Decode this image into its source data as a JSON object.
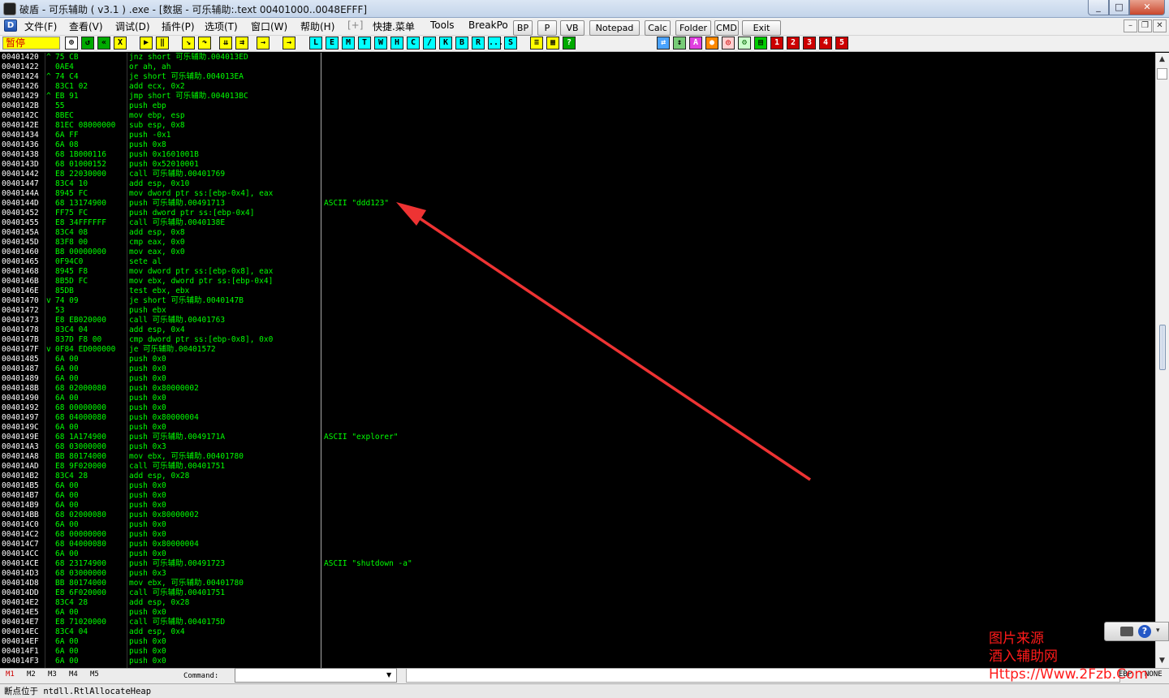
{
  "window": {
    "title": "破盾 - 可乐辅助 ( v3.1 ) .exe - [数据 - 可乐辅助:.text 00401000..0048EFFF]",
    "min": "_",
    "max": "□",
    "close": "✕"
  },
  "menu": [
    "文件(F)",
    "查看(V)",
    "调试(D)",
    "插件(P)",
    "选项(T)",
    "窗口(W)",
    "帮助(H)",
    "[+]",
    "快捷.菜单",
    "Tools",
    "BreakPo"
  ],
  "menu_mdi": [
    "–",
    "❐",
    "✕"
  ],
  "tool_buttons": [
    "BP",
    "P",
    "VB",
    "Notepad",
    "Calc",
    "Folder",
    "CMD",
    "Exit"
  ],
  "status_paused": "暂停",
  "letter_icons": [
    "L",
    "E",
    "M",
    "T",
    "W",
    "H",
    "C",
    "/",
    "K",
    "B",
    "R",
    "...",
    "S"
  ],
  "number_icons": [
    "1",
    "2",
    "3",
    "4",
    "5"
  ],
  "colors": {
    "code_text": "#00ff00",
    "address_text": "#ffffff",
    "background": "#000000",
    "paused_bg": "#ffff00",
    "paused_text": "#d00000",
    "arrow": "#ee3333",
    "watermark": "#ff1a1a"
  },
  "rows": [
    {
      "addr": "00401420",
      "jmp": "^",
      "hex": "75 CB",
      "dis": "jnz short 可乐辅助.004013ED",
      "comment": ""
    },
    {
      "addr": "00401422",
      "jmp": "",
      "hex": "0AE4",
      "dis": "or ah, ah",
      "comment": ""
    },
    {
      "addr": "00401424",
      "jmp": "^",
      "hex": "74 C4",
      "dis": "je short 可乐辅助.004013EA",
      "comment": ""
    },
    {
      "addr": "00401426",
      "jmp": "",
      "hex": "83C1 02",
      "dis": "add ecx, 0x2",
      "comment": ""
    },
    {
      "addr": "00401429",
      "jmp": "^",
      "hex": "EB 91",
      "dis": "jmp short 可乐辅助.004013BC",
      "comment": ""
    },
    {
      "addr": "0040142B",
      "jmp": "",
      "hex": "55",
      "dis": "push ebp",
      "comment": ""
    },
    {
      "addr": "0040142C",
      "jmp": "",
      "hex": "8BEC",
      "dis": "mov ebp, esp",
      "comment": ""
    },
    {
      "addr": "0040142E",
      "jmp": "",
      "hex": "81EC 08000000",
      "dis": "sub esp, 0x8",
      "comment": ""
    },
    {
      "addr": "00401434",
      "jmp": "",
      "hex": "6A FF",
      "dis": "push -0x1",
      "comment": ""
    },
    {
      "addr": "00401436",
      "jmp": "",
      "hex": "6A 08",
      "dis": "push 0x8",
      "comment": ""
    },
    {
      "addr": "00401438",
      "jmp": "",
      "hex": "68 1B000116",
      "dis": "push 0x1601001B",
      "comment": ""
    },
    {
      "addr": "0040143D",
      "jmp": "",
      "hex": "68 01000152",
      "dis": "push 0x52010001",
      "comment": ""
    },
    {
      "addr": "00401442",
      "jmp": "",
      "hex": "E8 22030000",
      "dis": "call 可乐辅助.00401769",
      "comment": ""
    },
    {
      "addr": "00401447",
      "jmp": "",
      "hex": "83C4 10",
      "dis": "add esp, 0x10",
      "comment": ""
    },
    {
      "addr": "0040144A",
      "jmp": "",
      "hex": "8945 FC",
      "dis": "mov dword ptr ss:[ebp-0x4], eax",
      "comment": ""
    },
    {
      "addr": "0040144D",
      "jmp": "",
      "hex": "68 13174900",
      "dis": "push 可乐辅助.00491713",
      "comment": "ASCII \"ddd123\""
    },
    {
      "addr": "00401452",
      "jmp": "",
      "hex": "FF75 FC",
      "dis": "push dword ptr ss:[ebp-0x4]",
      "comment": ""
    },
    {
      "addr": "00401455",
      "jmp": "",
      "hex": "E8 34FFFFFF",
      "dis": "call 可乐辅助.0040138E",
      "comment": ""
    },
    {
      "addr": "0040145A",
      "jmp": "",
      "hex": "83C4 08",
      "dis": "add esp, 0x8",
      "comment": ""
    },
    {
      "addr": "0040145D",
      "jmp": "",
      "hex": "83F8 00",
      "dis": "cmp eax, 0x0",
      "comment": ""
    },
    {
      "addr": "00401460",
      "jmp": "",
      "hex": "B8 00000000",
      "dis": "mov eax, 0x0",
      "comment": ""
    },
    {
      "addr": "00401465",
      "jmp": "",
      "hex": "0F94C0",
      "dis": "sete al",
      "comment": ""
    },
    {
      "addr": "00401468",
      "jmp": "",
      "hex": "8945 F8",
      "dis": "mov dword ptr ss:[ebp-0x8], eax",
      "comment": ""
    },
    {
      "addr": "0040146B",
      "jmp": "",
      "hex": "8B5D FC",
      "dis": "mov ebx, dword ptr ss:[ebp-0x4]",
      "comment": ""
    },
    {
      "addr": "0040146E",
      "jmp": "",
      "hex": "85DB",
      "dis": "test ebx, ebx",
      "comment": ""
    },
    {
      "addr": "00401470",
      "jmp": "v",
      "hex": "74 09",
      "dis": "je short 可乐辅助.0040147B",
      "comment": ""
    },
    {
      "addr": "00401472",
      "jmp": "",
      "hex": "53",
      "dis": "push ebx",
      "comment": ""
    },
    {
      "addr": "00401473",
      "jmp": "",
      "hex": "E8 EB020000",
      "dis": "call 可乐辅助.00401763",
      "comment": ""
    },
    {
      "addr": "00401478",
      "jmp": "",
      "hex": "83C4 04",
      "dis": "add esp, 0x4",
      "comment": ""
    },
    {
      "addr": "0040147B",
      "jmp": "",
      "hex": "837D F8 00",
      "dis": "cmp dword ptr ss:[ebp-0x8], 0x0",
      "comment": ""
    },
    {
      "addr": "0040147F",
      "jmp": "v",
      "hex": "0F84 ED000000",
      "dis": "je 可乐辅助.00401572",
      "comment": ""
    },
    {
      "addr": "00401485",
      "jmp": "",
      "hex": "6A 00",
      "dis": "push 0x0",
      "comment": ""
    },
    {
      "addr": "00401487",
      "jmp": "",
      "hex": "6A 00",
      "dis": "push 0x0",
      "comment": ""
    },
    {
      "addr": "00401489",
      "jmp": "",
      "hex": "6A 00",
      "dis": "push 0x0",
      "comment": ""
    },
    {
      "addr": "0040148B",
      "jmp": "",
      "hex": "68 02000080",
      "dis": "push 0x80000002",
      "comment": ""
    },
    {
      "addr": "00401490",
      "jmp": "",
      "hex": "6A 00",
      "dis": "push 0x0",
      "comment": ""
    },
    {
      "addr": "00401492",
      "jmp": "",
      "hex": "68 00000000",
      "dis": "push 0x0",
      "comment": ""
    },
    {
      "addr": "00401497",
      "jmp": "",
      "hex": "68 04000080",
      "dis": "push 0x80000004",
      "comment": ""
    },
    {
      "addr": "0040149C",
      "jmp": "",
      "hex": "6A 00",
      "dis": "push 0x0",
      "comment": ""
    },
    {
      "addr": "0040149E",
      "jmp": "",
      "hex": "68 1A174900",
      "dis": "push 可乐辅助.0049171A",
      "comment": "ASCII \"explorer\""
    },
    {
      "addr": "004014A3",
      "jmp": "",
      "hex": "68 03000000",
      "dis": "push 0x3",
      "comment": ""
    },
    {
      "addr": "004014A8",
      "jmp": "",
      "hex": "BB 80174000",
      "dis": "mov ebx, 可乐辅助.00401780",
      "comment": ""
    },
    {
      "addr": "004014AD",
      "jmp": "",
      "hex": "E8 9F020000",
      "dis": "call 可乐辅助.00401751",
      "comment": ""
    },
    {
      "addr": "004014B2",
      "jmp": "",
      "hex": "83C4 28",
      "dis": "add esp, 0x28",
      "comment": ""
    },
    {
      "addr": "004014B5",
      "jmp": "",
      "hex": "6A 00",
      "dis": "push 0x0",
      "comment": ""
    },
    {
      "addr": "004014B7",
      "jmp": "",
      "hex": "6A 00",
      "dis": "push 0x0",
      "comment": ""
    },
    {
      "addr": "004014B9",
      "jmp": "",
      "hex": "6A 00",
      "dis": "push 0x0",
      "comment": ""
    },
    {
      "addr": "004014BB",
      "jmp": "",
      "hex": "68 02000080",
      "dis": "push 0x80000002",
      "comment": ""
    },
    {
      "addr": "004014C0",
      "jmp": "",
      "hex": "6A 00",
      "dis": "push 0x0",
      "comment": ""
    },
    {
      "addr": "004014C2",
      "jmp": "",
      "hex": "68 00000000",
      "dis": "push 0x0",
      "comment": ""
    },
    {
      "addr": "004014C7",
      "jmp": "",
      "hex": "68 04000080",
      "dis": "push 0x80000004",
      "comment": ""
    },
    {
      "addr": "004014CC",
      "jmp": "",
      "hex": "6A 00",
      "dis": "push 0x0",
      "comment": ""
    },
    {
      "addr": "004014CE",
      "jmp": "",
      "hex": "68 23174900",
      "dis": "push 可乐辅助.00491723",
      "comment": "ASCII \"shutdown -a\""
    },
    {
      "addr": "004014D3",
      "jmp": "",
      "hex": "68 03000000",
      "dis": "push 0x3",
      "comment": ""
    },
    {
      "addr": "004014D8",
      "jmp": "",
      "hex": "BB 80174000",
      "dis": "mov ebx, 可乐辅助.00401780",
      "comment": ""
    },
    {
      "addr": "004014DD",
      "jmp": "",
      "hex": "E8 6F020000",
      "dis": "call 可乐辅助.00401751",
      "comment": ""
    },
    {
      "addr": "004014E2",
      "jmp": "",
      "hex": "83C4 28",
      "dis": "add esp, 0x28",
      "comment": ""
    },
    {
      "addr": "004014E5",
      "jmp": "",
      "hex": "6A 00",
      "dis": "push 0x0",
      "comment": ""
    },
    {
      "addr": "004014E7",
      "jmp": "",
      "hex": "E8 71020000",
      "dis": "call 可乐辅助.0040175D",
      "comment": ""
    },
    {
      "addr": "004014EC",
      "jmp": "",
      "hex": "83C4 04",
      "dis": "add esp, 0x4",
      "comment": ""
    },
    {
      "addr": "004014EF",
      "jmp": "",
      "hex": "6A 00",
      "dis": "push 0x0",
      "comment": ""
    },
    {
      "addr": "004014F1",
      "jmp": "",
      "hex": "6A 00",
      "dis": "push 0x0",
      "comment": ""
    },
    {
      "addr": "004014F3",
      "jmp": "",
      "hex": "6A 00",
      "dis": "push 0x0",
      "comment": ""
    }
  ],
  "bottom": {
    "tabs": [
      "M1",
      "M2",
      "M3",
      "M4",
      "M5"
    ],
    "command_label": "Command:",
    "command_value": "",
    "ebp_label": "EBP",
    "none_label": "NONE"
  },
  "status": "断点位于 ntdll.RtlAllocateHeap",
  "watermark": [
    "图片来源",
    "酒入辅助网",
    "Https://Www.2Fzb.Com"
  ]
}
